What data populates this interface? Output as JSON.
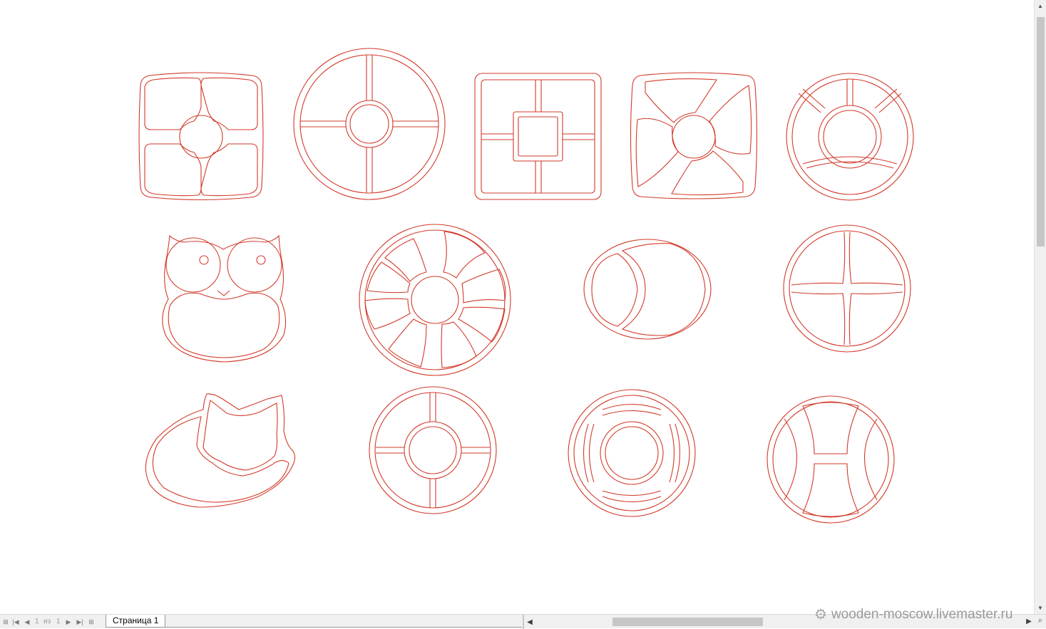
{
  "page_nav": {
    "first_icon": "first-page-icon",
    "prev_icon": "prev-page-icon",
    "current_page": "1",
    "of_label": "из",
    "total_pages": "1",
    "next_icon": "next-page-icon",
    "last_icon": "last-page-icon",
    "add_icon": "add-page-icon"
  },
  "page_tab": {
    "label": "Страница 1"
  },
  "watermark": {
    "text": "wooden-moscow.livemaster.ru"
  },
  "colors": {
    "outline": "#d23a2a",
    "background": "#ffffff",
    "scrollbar": "#c6c6c6"
  },
  "shapes": [
    "rounded-square-tray-4-compartments",
    "circle-tray-4-compartments",
    "square-tray-5-compartments",
    "pinwheel-square-tray",
    "ring-tray-4-compartments",
    "owl-tray",
    "flower-circle-tray-8-compartments",
    "oval-tray-2-compartments",
    "circle-cross-tray",
    "fox-tray",
    "ring-tray-5-compartments",
    "lifebuoy-tray",
    "circle-h-tray"
  ]
}
